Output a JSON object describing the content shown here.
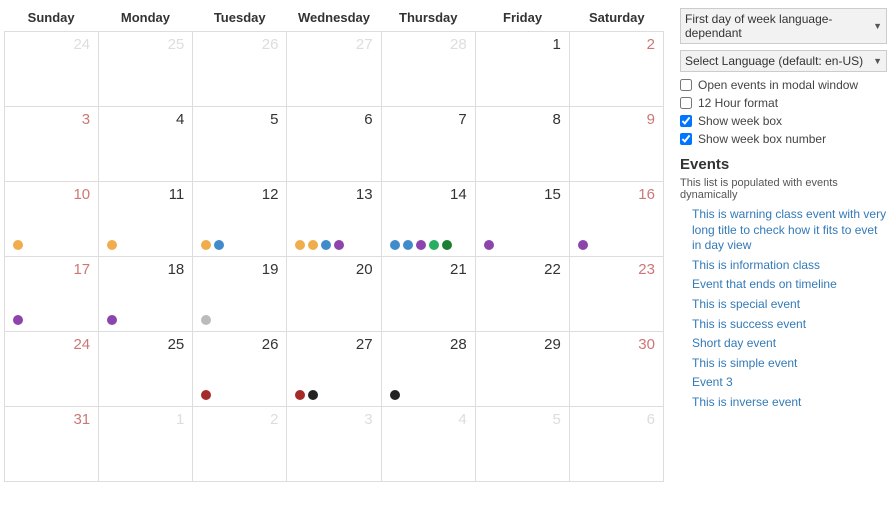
{
  "weekdays": [
    "Sunday",
    "Monday",
    "Tuesday",
    "Wednesday",
    "Thursday",
    "Friday",
    "Saturday"
  ],
  "weeks": [
    [
      {
        "n": "24",
        "cls": "muted",
        "dots": []
      },
      {
        "n": "25",
        "cls": "muted",
        "dots": []
      },
      {
        "n": "26",
        "cls": "muted",
        "dots": []
      },
      {
        "n": "27",
        "cls": "muted",
        "dots": []
      },
      {
        "n": "28",
        "cls": "muted",
        "dots": []
      },
      {
        "n": "1",
        "cls": "today",
        "dots": []
      },
      {
        "n": "2",
        "cls": "weekend",
        "dots": []
      }
    ],
    [
      {
        "n": "3",
        "cls": "weekend",
        "dots": []
      },
      {
        "n": "4",
        "cls": "today",
        "dots": []
      },
      {
        "n": "5",
        "cls": "today",
        "dots": []
      },
      {
        "n": "6",
        "cls": "today",
        "dots": []
      },
      {
        "n": "7",
        "cls": "today",
        "dots": []
      },
      {
        "n": "8",
        "cls": "today",
        "dots": []
      },
      {
        "n": "9",
        "cls": "weekend",
        "dots": []
      }
    ],
    [
      {
        "n": "10",
        "cls": "weekend",
        "dots": [
          "yellow"
        ]
      },
      {
        "n": "11",
        "cls": "today",
        "dots": [
          "yellow"
        ]
      },
      {
        "n": "12",
        "cls": "today",
        "dots": [
          "yellow",
          "blue"
        ]
      },
      {
        "n": "13",
        "cls": "today",
        "dots": [
          "yellow",
          "yellow",
          "blue",
          "purple"
        ]
      },
      {
        "n": "14",
        "cls": "today",
        "dots": [
          "blue",
          "blue",
          "purple",
          "green",
          "darkgreen"
        ]
      },
      {
        "n": "15",
        "cls": "today",
        "dots": [
          "purple"
        ]
      },
      {
        "n": "16",
        "cls": "weekend",
        "dots": [
          "purple"
        ]
      }
    ],
    [
      {
        "n": "17",
        "cls": "weekend",
        "dots": [
          "purple"
        ]
      },
      {
        "n": "18",
        "cls": "today",
        "dots": [
          "purple"
        ]
      },
      {
        "n": "19",
        "cls": "today",
        "dots": [
          "gray"
        ]
      },
      {
        "n": "20",
        "cls": "today",
        "dots": []
      },
      {
        "n": "21",
        "cls": "today",
        "dots": []
      },
      {
        "n": "22",
        "cls": "today",
        "dots": []
      },
      {
        "n": "23",
        "cls": "weekend",
        "dots": []
      }
    ],
    [
      {
        "n": "24",
        "cls": "weekend",
        "dots": []
      },
      {
        "n": "25",
        "cls": "today",
        "dots": []
      },
      {
        "n": "26",
        "cls": "today",
        "dots": [
          "darkred"
        ]
      },
      {
        "n": "27",
        "cls": "today",
        "dots": [
          "darkred",
          "black"
        ]
      },
      {
        "n": "28",
        "cls": "today",
        "dots": [
          "black"
        ]
      },
      {
        "n": "29",
        "cls": "today",
        "dots": []
      },
      {
        "n": "30",
        "cls": "weekend",
        "dots": []
      }
    ],
    [
      {
        "n": "31",
        "cls": "weekend",
        "dots": []
      },
      {
        "n": "1",
        "cls": "muted",
        "dots": []
      },
      {
        "n": "2",
        "cls": "muted",
        "dots": []
      },
      {
        "n": "3",
        "cls": "muted",
        "dots": []
      },
      {
        "n": "4",
        "cls": "muted",
        "dots": []
      },
      {
        "n": "5",
        "cls": "muted",
        "dots": []
      },
      {
        "n": "6",
        "cls": "muted",
        "dots": []
      }
    ]
  ],
  "selects": {
    "firstday": "First day of week language-dependant",
    "language": "Select Language (default: en-US)"
  },
  "checks": [
    {
      "label": "Open events in modal window",
      "checked": false
    },
    {
      "label": "12 Hour format",
      "checked": false
    },
    {
      "label": "Show week box",
      "checked": true
    },
    {
      "label": "Show week box number",
      "checked": true
    }
  ],
  "eventsHeading": "Events",
  "eventsSub": "This list is populated with events dynamically",
  "events": [
    "This is warning class event with very long title to check how it fits to evet in day view",
    "This is information class",
    "Event that ends on timeline",
    "This is special event",
    "This is success event",
    "Short day event",
    "This is simple event",
    "Event 3",
    "This is inverse event"
  ]
}
